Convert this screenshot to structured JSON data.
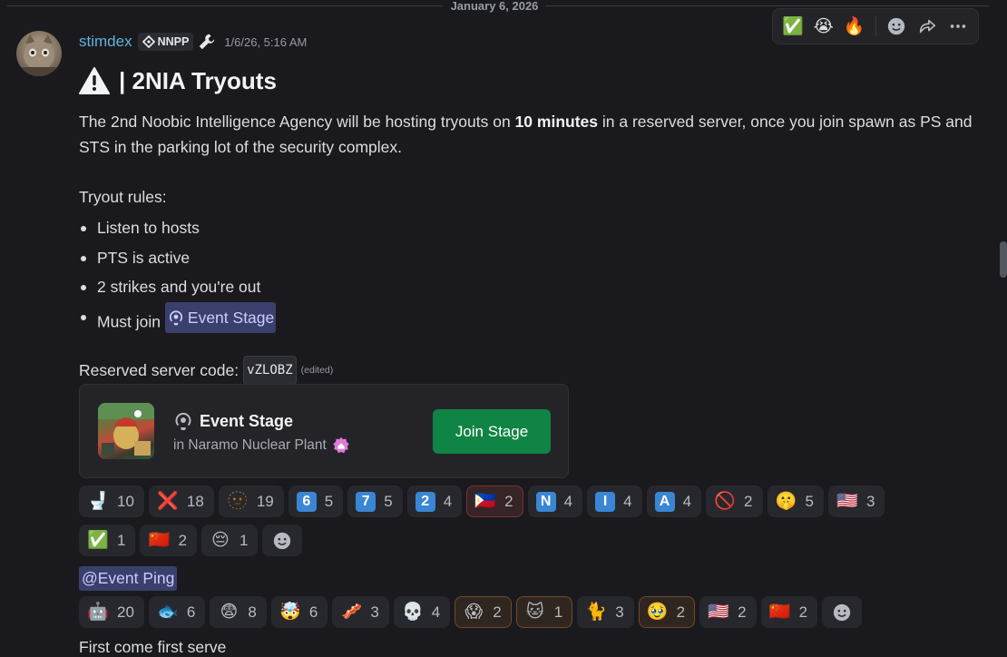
{
  "date_divider": "January 6, 2026",
  "message": {
    "username": "stimdex",
    "tag": "NNPP",
    "timestamp": "1/6/26, 5:16 AM",
    "title": "| 2NIA Tryouts",
    "para_before": "The 2nd Noobic Intelligence Agency will be hosting tryouts on ",
    "para_bold": "10 minutes",
    "para_after": " in a reserved server, once you join spawn as PS and STS in the parking lot of the security complex.",
    "rules_heading": "Tryout rules:",
    "rules": [
      "Listen to hosts",
      "PTS is active",
      "2 strikes and you're out",
      "Must join"
    ],
    "channel_mention": "Event Stage",
    "code_label": "Reserved server code:",
    "code": "vZLOBZ",
    "edited": "(edited)",
    "role_mention": "@Event Ping",
    "trailing": "First come first serve"
  },
  "embed": {
    "title": "Event Stage",
    "subtitle": "in Naramo Nuclear Plant",
    "button": "Join Stage"
  },
  "reactions_row1": [
    {
      "emoji": "🚽",
      "count": "10"
    },
    {
      "emoji": "❌",
      "count": "18"
    },
    {
      "emoji": "🫥",
      "count": "19"
    },
    {
      "sq": "6",
      "count": "5"
    },
    {
      "sq": "7",
      "count": "5"
    },
    {
      "sq": "2",
      "count": "4"
    },
    {
      "emoji": "🇵🇭",
      "count": "2",
      "me": true
    },
    {
      "sq": "N",
      "count": "4"
    },
    {
      "sq": "I",
      "count": "4"
    },
    {
      "sq": "A",
      "count": "4"
    },
    {
      "emoji": "🚫",
      "count": "2"
    },
    {
      "emoji": "🤫",
      "count": "5"
    },
    {
      "emoji": "🇺🇸",
      "count": "3"
    }
  ],
  "reactions_row2": [
    {
      "emoji": "✅",
      "count": "1"
    },
    {
      "emoji": "🇨🇳",
      "count": "2"
    },
    {
      "emoji": "😔",
      "count": "1"
    }
  ],
  "reactions_row3": [
    {
      "emoji": "🤖",
      "count": "20"
    },
    {
      "emoji": "🐟",
      "count": "6"
    },
    {
      "emoji": "😨",
      "count": "8"
    },
    {
      "emoji": "🤯",
      "count": "6"
    },
    {
      "emoji": "🥓",
      "count": "3"
    },
    {
      "emoji": "💀",
      "count": "4"
    },
    {
      "emoji": "😱",
      "count": "2",
      "me2": true
    },
    {
      "emoji": "🐱",
      "count": "1",
      "me2": true
    },
    {
      "emoji": "🐈",
      "count": "3"
    },
    {
      "emoji": "🥹",
      "count": "2",
      "me2": true
    },
    {
      "emoji": "🇺🇸",
      "count": "2"
    },
    {
      "emoji": "🇨🇳",
      "count": "2"
    }
  ],
  "toolbar": {
    "emojis": [
      "✅",
      "😭",
      "🔥"
    ],
    "icons": [
      "add-reaction-icon",
      "forward-icon",
      "more-icon"
    ]
  }
}
